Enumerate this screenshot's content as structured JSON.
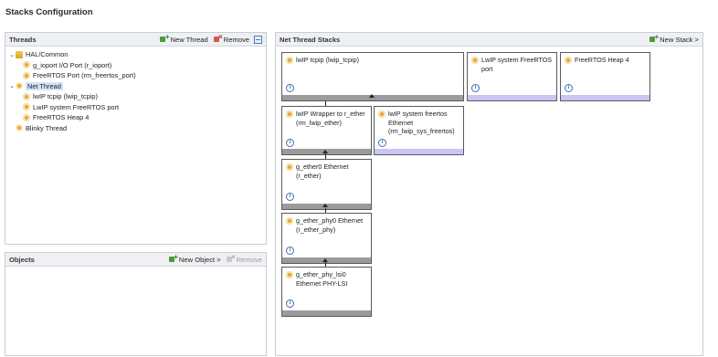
{
  "title": "Stacks Configuration",
  "threads": {
    "header": "Threads",
    "new_thread": "New Thread",
    "remove": "Remove",
    "tree": {
      "hal_common": "HAL/Common",
      "ioport": "g_ioport I/O Port (r_ioport)",
      "freertos_port": "FreeRTOS Port (rm_freertos_port)",
      "net_thread": "Net Thread",
      "lwip_tcpip": "lwIP tcpip (lwip_tcpip)",
      "lwip_sys_port": "LwIP system FreeRTOS port",
      "heap4": "FreeRTOS Heap 4",
      "blinky": "Blinky Thread"
    }
  },
  "objects": {
    "header": "Objects",
    "new_object": "New Object >",
    "remove": "Remove"
  },
  "stacks": {
    "header": "Net Thread Stacks",
    "new_stack": "New Stack >",
    "info_glyph": "i",
    "boxes": {
      "tcpip": "lwIP tcpip (lwip_tcpip)",
      "sysport": "LwIP system FreeRTOS port",
      "heap4": "FreeRTOS Heap 4",
      "wrapper": "lwIP Wrapper to r_ether (rm_lwip_ether)",
      "sysfreertos": "lwIP system freertos Ethernet (rm_lwip_sys_freertos)",
      "ether0": "g_ether0 Ethernet (r_ether)",
      "phy0": "g_ether_phy0 Ethernet (r_ether_phy)",
      "lsi0": "g_ether_phy_lsi0 Ethernet PHY-LSI"
    }
  }
}
